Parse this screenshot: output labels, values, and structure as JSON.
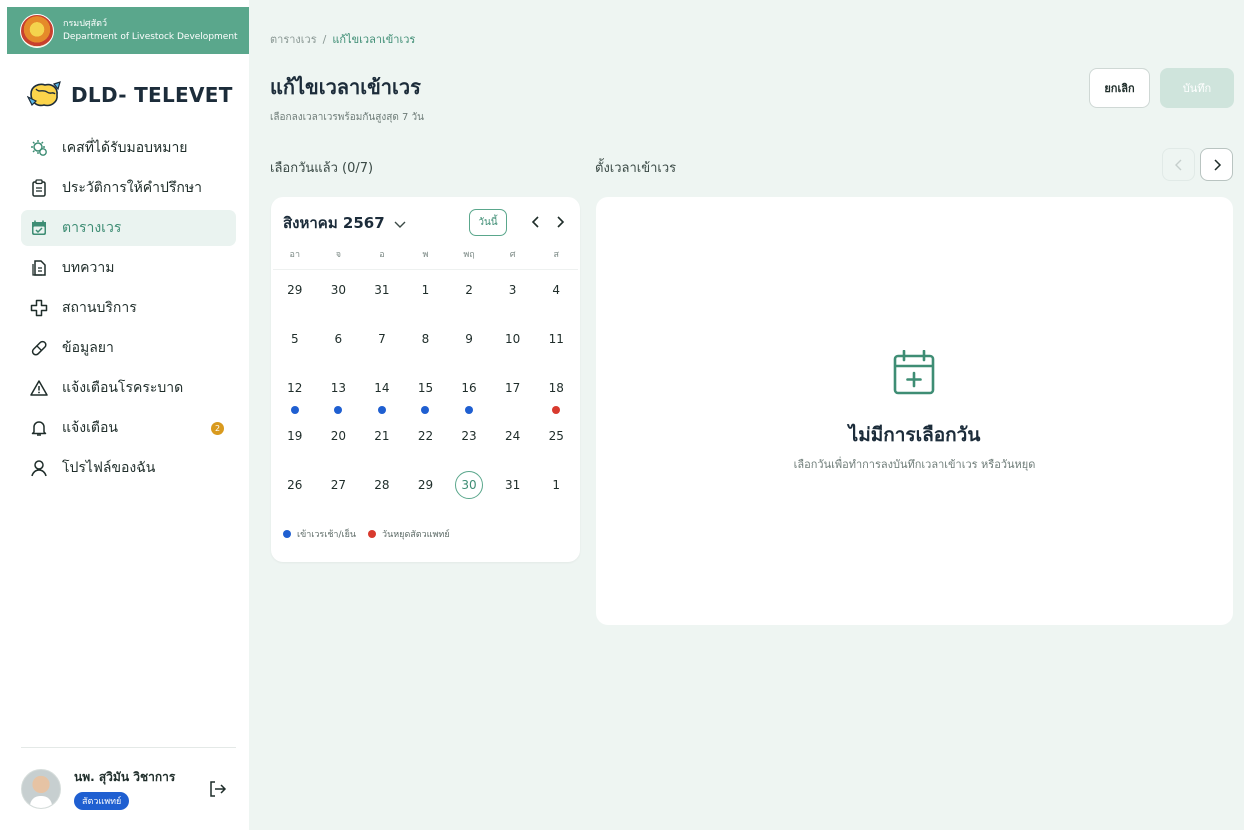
{
  "org": {
    "name_th": "กรมปศุสัตว์",
    "name_en": "Department of Livestock Development"
  },
  "brand": {
    "name": "DLD- TELEVET"
  },
  "sidebar": {
    "items": [
      {
        "label": "เคสที่ได้รับมอบหมาย",
        "icon": "assigned-cases-icon",
        "active": false
      },
      {
        "label": "ประวัติการให้คำปรึกษา",
        "icon": "clipboard-icon",
        "active": false
      },
      {
        "label": "ตารางเวร",
        "icon": "calendar-check-icon",
        "active": true
      },
      {
        "label": "บทความ",
        "icon": "document-icon",
        "active": false
      },
      {
        "label": "สถานบริการ",
        "icon": "plus-outline-icon",
        "active": false
      },
      {
        "label": "ข้อมูลยา",
        "icon": "pill-icon",
        "active": false
      },
      {
        "label": "แจ้งเตือนโรคระบาด",
        "icon": "warning-icon",
        "active": false
      },
      {
        "label": "แจ้งเตือน",
        "icon": "bell-icon",
        "active": false,
        "badge": "2"
      },
      {
        "label": "โปรไฟล์ของฉัน",
        "icon": "user-icon",
        "active": false
      }
    ]
  },
  "user": {
    "name": "นพ. สุวิมัน วิชาการ",
    "role": "สัตวแพทย์"
  },
  "main": {
    "breadcrumb": {
      "parent": "ตารางเวร",
      "separator": "/",
      "current": "แก้ไขเวลาเข้าเวร"
    },
    "title": "แก้ไขเวลาเข้าเวร",
    "subtitle": "เลือกลงเวลาเวรพร้อมกันสูงสุด 7 วัน",
    "cancel_label": "ยกเลิก",
    "save_label": "บันทึก",
    "selected_count": "เลือกวันแล้ว (0/7)",
    "set_time_label": "ตั้งเวลาเข้าเวร"
  },
  "calendar": {
    "month_label": "สิงหาคม 2567",
    "today_label": "วันนี้",
    "weekdays": [
      "อา",
      "จ",
      "อ",
      "พ",
      "พฤ",
      "ศ",
      "ส"
    ],
    "days": [
      {
        "d": "29",
        "dot": null
      },
      {
        "d": "30",
        "dot": null
      },
      {
        "d": "31",
        "dot": null
      },
      {
        "d": "1",
        "dot": null
      },
      {
        "d": "2",
        "dot": null
      },
      {
        "d": "3",
        "dot": null
      },
      {
        "d": "4",
        "dot": null
      },
      {
        "d": "5",
        "dot": null
      },
      {
        "d": "6",
        "dot": null
      },
      {
        "d": "7",
        "dot": null
      },
      {
        "d": "8",
        "dot": null
      },
      {
        "d": "9",
        "dot": null
      },
      {
        "d": "10",
        "dot": null
      },
      {
        "d": "11",
        "dot": null
      },
      {
        "d": "12",
        "dot": "shift"
      },
      {
        "d": "13",
        "dot": "shift"
      },
      {
        "d": "14",
        "dot": "shift"
      },
      {
        "d": "15",
        "dot": "shift"
      },
      {
        "d": "16",
        "dot": "shift"
      },
      {
        "d": "17",
        "dot": null
      },
      {
        "d": "18",
        "dot": "holiday"
      },
      {
        "d": "19",
        "dot": null
      },
      {
        "d": "20",
        "dot": null
      },
      {
        "d": "21",
        "dot": null
      },
      {
        "d": "22",
        "dot": null
      },
      {
        "d": "23",
        "dot": null
      },
      {
        "d": "24",
        "dot": null
      },
      {
        "d": "25",
        "dot": null
      },
      {
        "d": "26",
        "dot": null
      },
      {
        "d": "27",
        "dot": null
      },
      {
        "d": "28",
        "dot": null
      },
      {
        "d": "29",
        "dot": null
      },
      {
        "d": "30",
        "dot": null,
        "today": true
      },
      {
        "d": "31",
        "dot": null
      },
      {
        "d": "1",
        "dot": null
      }
    ],
    "legend": [
      {
        "label": "เข้าเวรเช้า/เย็น",
        "color": "#1f5fd1"
      },
      {
        "label": "วันหยุดสัตวแพทย์",
        "color": "#d83a2e"
      }
    ]
  },
  "empty_state": {
    "title": "ไม่มีการเลือกวัน",
    "subtitle": "เลือกวันเพื่อทำการลงบันทึกเวลาเข้าเวร หรือวันหยุด"
  },
  "colors": {
    "accent": "#3e8d74",
    "org_bar": "#5aa78c",
    "shift_dot": "#1f5fd1",
    "holiday_dot": "#d83a2e",
    "badge": "#d99a1e"
  }
}
